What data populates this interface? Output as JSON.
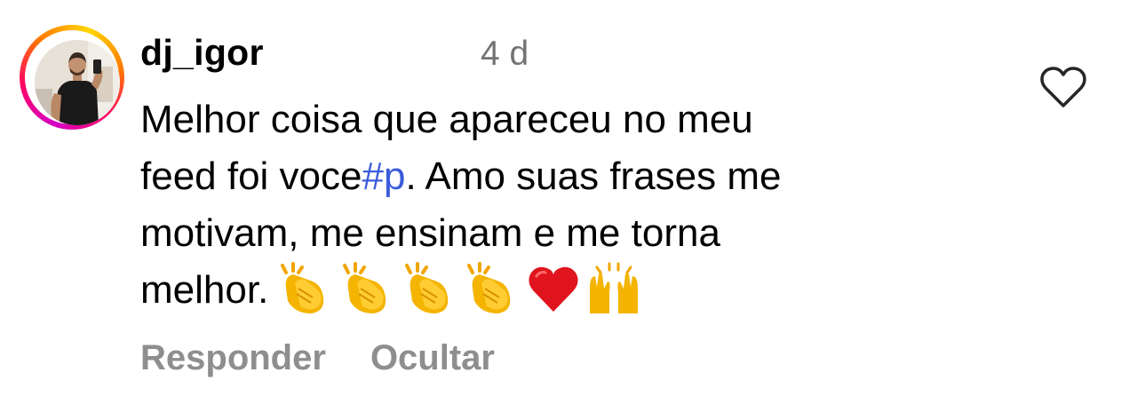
{
  "comment": {
    "username": "dj_igor",
    "timestamp": "4 d",
    "text_lines": [
      "Melhor coisa que apareceu no meu",
      "feed foi voce",
      ". Amo suas frases me",
      "motivam, me ensinam e me torna",
      "melhor."
    ],
    "hashtag": "#p",
    "emojis": [
      "clapping-hands-emoji",
      "clapping-hands-emoji",
      "clapping-hands-emoji",
      "clapping-hands-emoji",
      "red-heart-emoji",
      "raising-hands-emoji"
    ],
    "like_icon": "heart-outline-icon",
    "avatar_icon": "profile-photo",
    "actions": {
      "reply_label": "Responder",
      "hide_label": "Ocultar"
    }
  },
  "colors": {
    "text": "#000000",
    "timestamp": "#737373",
    "hashtag": "#3b5bdb",
    "action": "#8e8e8e",
    "icon": "#262626"
  }
}
